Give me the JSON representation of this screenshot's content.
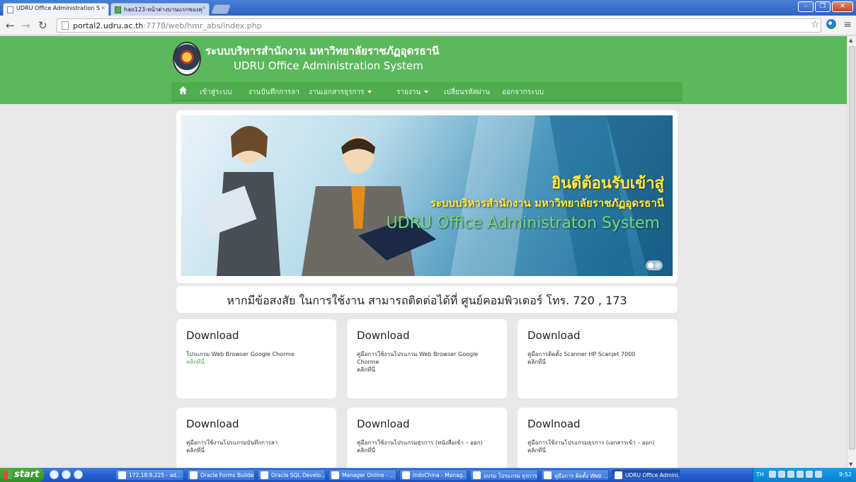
{
  "browser": {
    "tabs": [
      {
        "label": "UDRU Office Administration S"
      },
      {
        "label": "hao123-หน้าต่างบานแรกของคุ"
      }
    ],
    "url": {
      "host": "portal2.udru.ac.th",
      "path": ":7778/web/hmr_abs/index.php"
    }
  },
  "site": {
    "title_th": "ระบบบริหารสำนักงาน มหาวิทยาลัยราชภัฏอุดรธานี",
    "title_en": "UDRU Office Administration System",
    "menu": [
      {
        "label": "เข้าสู่ระบบ",
        "dropdown": false
      },
      {
        "label": "งานบันทึกการลา",
        "dropdown": false
      },
      {
        "label": "งานเอกสารธุรการ",
        "dropdown": true
      },
      {
        "label": "รายงาน",
        "dropdown": true
      },
      {
        "label": "เปลี่ยนรหัสผ่าน",
        "dropdown": false
      },
      {
        "label": "ออกจากระบบ",
        "dropdown": false
      }
    ]
  },
  "banner": {
    "welcome": "ยินดีต้อนรับเข้าสู่",
    "subtitle": "ระบบบริหารสำนักงาน มหาวิทยาลัยราชภัฏอุดรธานี",
    "english": "UDRU Office Administraton System"
  },
  "contact": {
    "text": "หากมีข้อสงสัย ในการใช้งาน สามารถติดต่อได้ที่ ศูนย์คอมพิวเตอร์ โทร. 720 , 173"
  },
  "cards": [
    {
      "title": "Download",
      "desc": "โปรแกรม Web Browser Google Chorme",
      "link": "คลิกที่นี่",
      "link_green": true
    },
    {
      "title": "Download",
      "desc": "คู่มือการใช้งานโปรแกรม Web Browser Google Chorme",
      "link": "คลิกที่นี่",
      "link_green": false
    },
    {
      "title": "Download",
      "desc": "คู่มือการติดตั้ง Scanner HP Scanjet 7000",
      "link": "คลิกที่นี่",
      "link_green": false
    },
    {
      "title": "Download",
      "desc": "คู่มือการใช้งานโปรแกรมบันทึกการลา",
      "link": "คลิกที่นี่",
      "link_green": false
    },
    {
      "title": "Download",
      "desc": "คู่มือการใช้งานโปรแกรมธุรการ (หนังสือเข้า – ออก)",
      "link": "คลิกที่นี่",
      "link_green": false
    },
    {
      "title": "Dowlnoad",
      "desc": "คู่มือการใช้งานโปรแกรมธุรการ (เอกสารเข้า – ออก)",
      "link": "คลิกที่นี่",
      "link_green": false
    }
  ],
  "taskbar": {
    "start": "start",
    "buttons": [
      "172.18.8.225 - ad...",
      "Oracle Forms Builde...",
      "Oracle SQL Develo...",
      "Manager Online - ...",
      "IndoChina - Manag...",
      "อบรม โปรแกรม ธุรการ",
      "คู่มือการ ติดตั้ง Web ...",
      "UDRU Office Admini..."
    ],
    "lang": "TH",
    "clock": "9:52"
  },
  "colors": {
    "header_green": "#5cb85c",
    "menu_green": "#4eae4e",
    "link_green": "#4caf50",
    "banner_text": "#ffeb3b"
  }
}
